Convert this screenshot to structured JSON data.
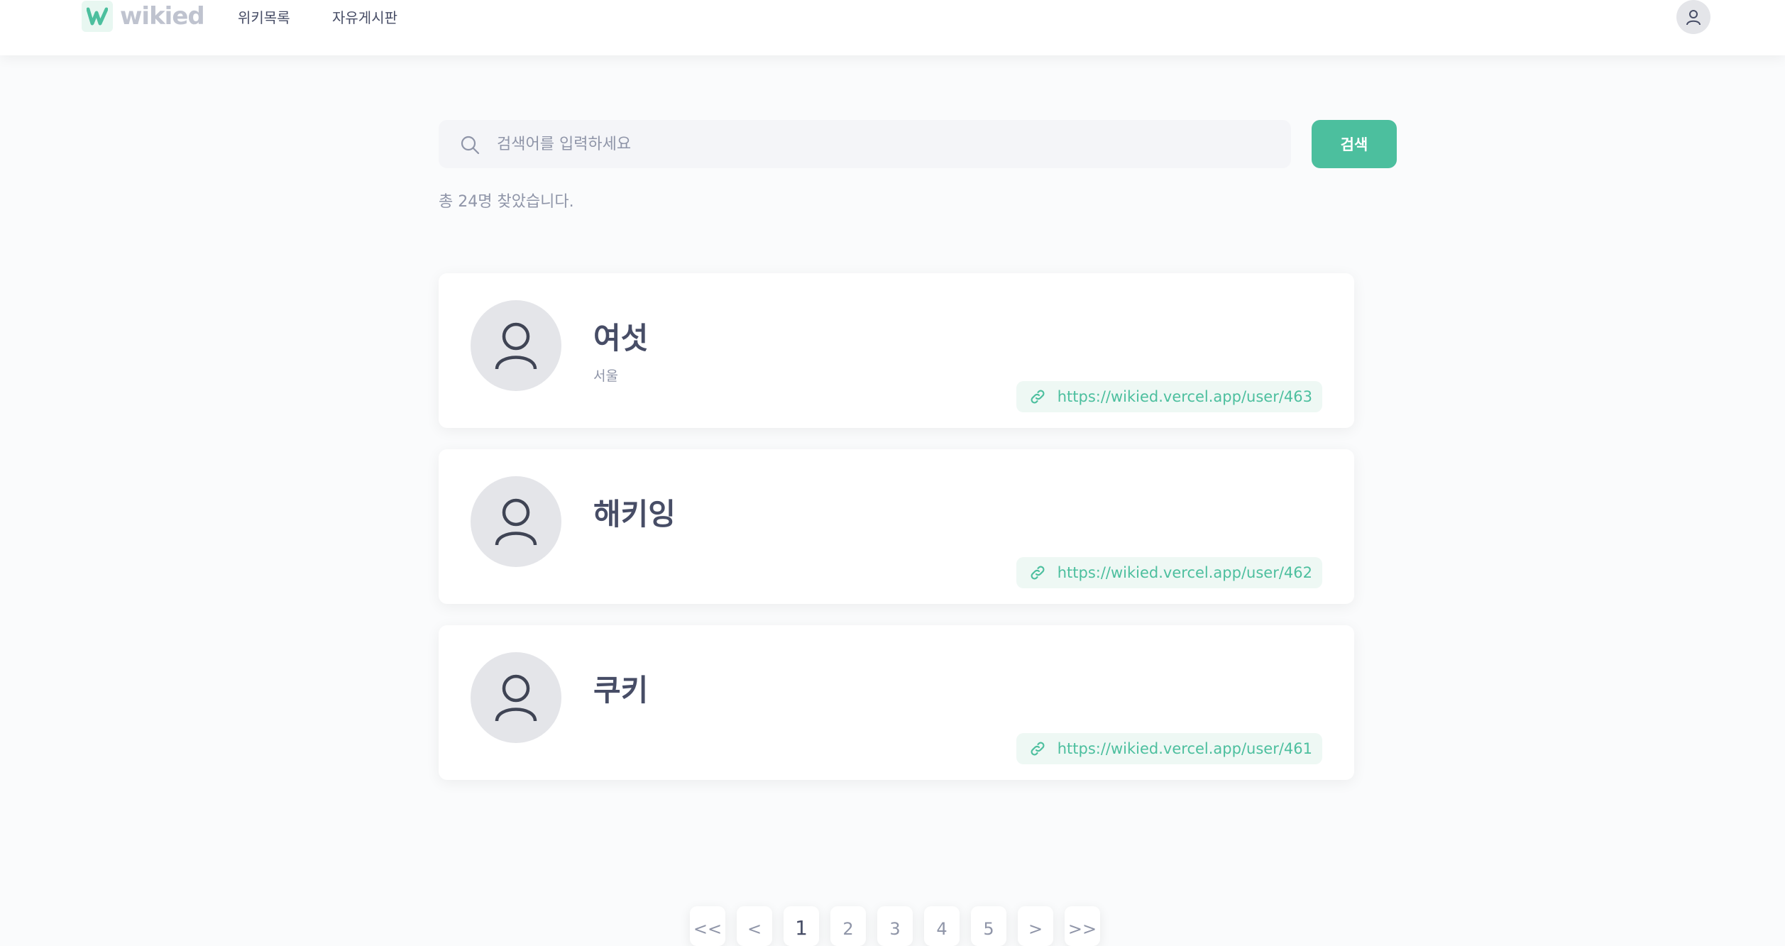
{
  "header": {
    "logo_text": "wikied",
    "nav": [
      {
        "label": "위키목록"
      },
      {
        "label": "자유게시판"
      }
    ],
    "avatar_icon": "user-icon"
  },
  "search": {
    "placeholder": "검색어를 입력하세요",
    "value": "",
    "button_label": "검색",
    "icon": "search-icon"
  },
  "results": {
    "count_text": "총 24명 찾았습니다.",
    "items": [
      {
        "name": "여섯",
        "location": "서울",
        "url": "https://wikied.vercel.app/user/463"
      },
      {
        "name": "해키잉",
        "location": "",
        "url": "https://wikied.vercel.app/user/462"
      },
      {
        "name": "쿠키",
        "location": "",
        "url": "https://wikied.vercel.app/user/461"
      }
    ]
  },
  "pagination": {
    "first": "<<",
    "prev": "<",
    "pages": [
      "1",
      "2",
      "3",
      "4",
      "5"
    ],
    "current": "1",
    "next": ">",
    "last": ">>"
  },
  "colors": {
    "accent": "#4cbf9e",
    "text": "#474d66",
    "muted": "#8f95a8"
  }
}
